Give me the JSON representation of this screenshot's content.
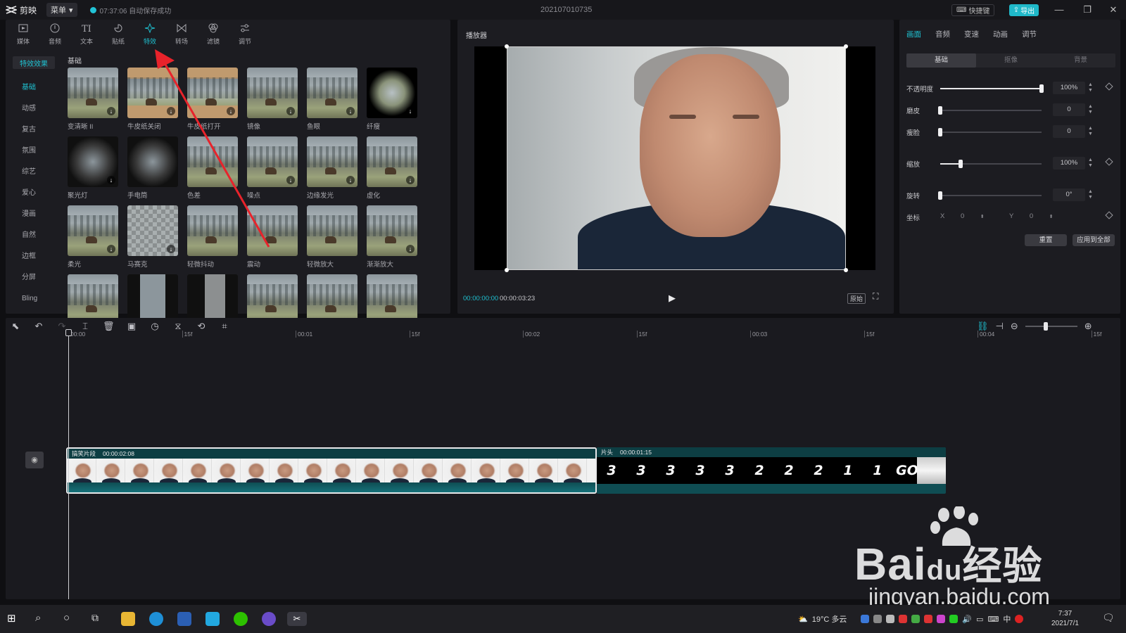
{
  "app": {
    "name": "剪映",
    "menu_label": "菜单",
    "save_status": "07:37:06 自动保存成功",
    "project_title": "202107010735",
    "shortcut_label": "快捷键",
    "export_label": "导出"
  },
  "tool_tabs": [
    {
      "label": "媒体",
      "icon": "media-icon"
    },
    {
      "label": "音频",
      "icon": "audio-icon"
    },
    {
      "label": "文本",
      "icon": "text-icon"
    },
    {
      "label": "贴纸",
      "icon": "sticker-icon"
    },
    {
      "label": "特效",
      "icon": "effects-icon",
      "active": true
    },
    {
      "label": "转场",
      "icon": "transition-icon"
    },
    {
      "label": "滤镜",
      "icon": "filter-icon"
    },
    {
      "label": "调节",
      "icon": "adjust-icon"
    }
  ],
  "effects": {
    "category_header": "特效效果",
    "categories": [
      "基础",
      "动感",
      "复古",
      "氛围",
      "综艺",
      "爱心",
      "漫画",
      "自然",
      "边框",
      "分屏",
      "Bling"
    ],
    "active_category": "基础",
    "section_title": "基础",
    "items": [
      {
        "label": "变清晰 II",
        "style": "normal",
        "download": true
      },
      {
        "label": "牛皮纸关闭",
        "style": "kraft",
        "download": true
      },
      {
        "label": "牛皮纸打开",
        "style": "kraft",
        "download": true
      },
      {
        "label": "镜像",
        "style": "normal",
        "download": true
      },
      {
        "label": "鱼眼",
        "style": "normal",
        "download": true
      },
      {
        "label": "纤瘦",
        "style": "vignette",
        "download": true
      },
      {
        "label": "聚光灯",
        "style": "dark",
        "download": true
      },
      {
        "label": "手电筒",
        "style": "dark",
        "download": false
      },
      {
        "label": "色差",
        "style": "normal",
        "download": false
      },
      {
        "label": "噪点",
        "style": "normal",
        "download": true
      },
      {
        "label": "边缘发光",
        "style": "normal",
        "download": true
      },
      {
        "label": "虚化",
        "style": "normal",
        "download": true
      },
      {
        "label": "柔光",
        "style": "normal",
        "download": true
      },
      {
        "label": "马赛克",
        "style": "mosaic",
        "download": true
      },
      {
        "label": "轻微抖动",
        "style": "normal",
        "download": false
      },
      {
        "label": "震动",
        "style": "normal",
        "download": false
      },
      {
        "label": "轻微放大",
        "style": "normal",
        "download": false
      },
      {
        "label": "渐渐放大",
        "style": "normal",
        "download": true
      },
      {
        "label": "",
        "style": "normal",
        "download": false
      },
      {
        "label": "",
        "style": "strip",
        "download": false
      },
      {
        "label": "",
        "style": "strip2",
        "download": false
      },
      {
        "label": "",
        "style": "normal",
        "download": false
      },
      {
        "label": "",
        "style": "normal",
        "download": false
      },
      {
        "label": "",
        "style": "normal",
        "download": false
      }
    ]
  },
  "player": {
    "title": "播放器",
    "current_time": "00:00:00:00",
    "total_time": "00:00:03:23",
    "ratio_label": "原始"
  },
  "properties": {
    "tabs": [
      "画面",
      "音频",
      "变速",
      "动画",
      "调节"
    ],
    "active_tab": "画面",
    "segments": [
      "基础",
      "抠像",
      "背景"
    ],
    "active_segment": "基础",
    "rows": [
      {
        "label": "不透明度",
        "value": "100%",
        "level": 1.0,
        "keyframe": true
      },
      {
        "label": "磨皮",
        "value": "0",
        "level": 0.0,
        "keyframe": false
      },
      {
        "label": "瘦脸",
        "value": "0",
        "level": 0.0,
        "keyframe": false
      },
      {
        "label": "缩放",
        "value": "100%",
        "level": 0.2,
        "keyframe": true
      },
      {
        "label": "旋转",
        "value": "0°",
        "level": 0.0,
        "keyframe": false
      }
    ],
    "position": {
      "label": "坐标",
      "x_label": "X",
      "x_value": "0",
      "y_label": "Y",
      "y_value": "0"
    },
    "reset_label": "重置",
    "apply_all_label": "应用到全部"
  },
  "timeline": {
    "ruler": [
      "00:00",
      "15f",
      "00:01",
      "15f",
      "00:02",
      "15f",
      "00:03",
      "15f",
      "00:04",
      "15f"
    ],
    "clip1": {
      "name": "搞笑片段",
      "duration": "00:00:02:08",
      "frame_count": 18
    },
    "clip2": {
      "name": "片头",
      "duration": "00:00:01:15",
      "countdown": [
        "3",
        "3",
        "3",
        "3",
        "3",
        "2",
        "2",
        "2",
        "1",
        "1",
        "GO"
      ]
    }
  },
  "taskbar": {
    "weather": "19°C 多云",
    "ime": "中",
    "time": "7:37",
    "date": "2021/7/1"
  },
  "watermark": {
    "brand": "Bai",
    "brand_suffix": "du",
    "brand_cn": "经验",
    "url": "jingyan.baidu.com"
  }
}
